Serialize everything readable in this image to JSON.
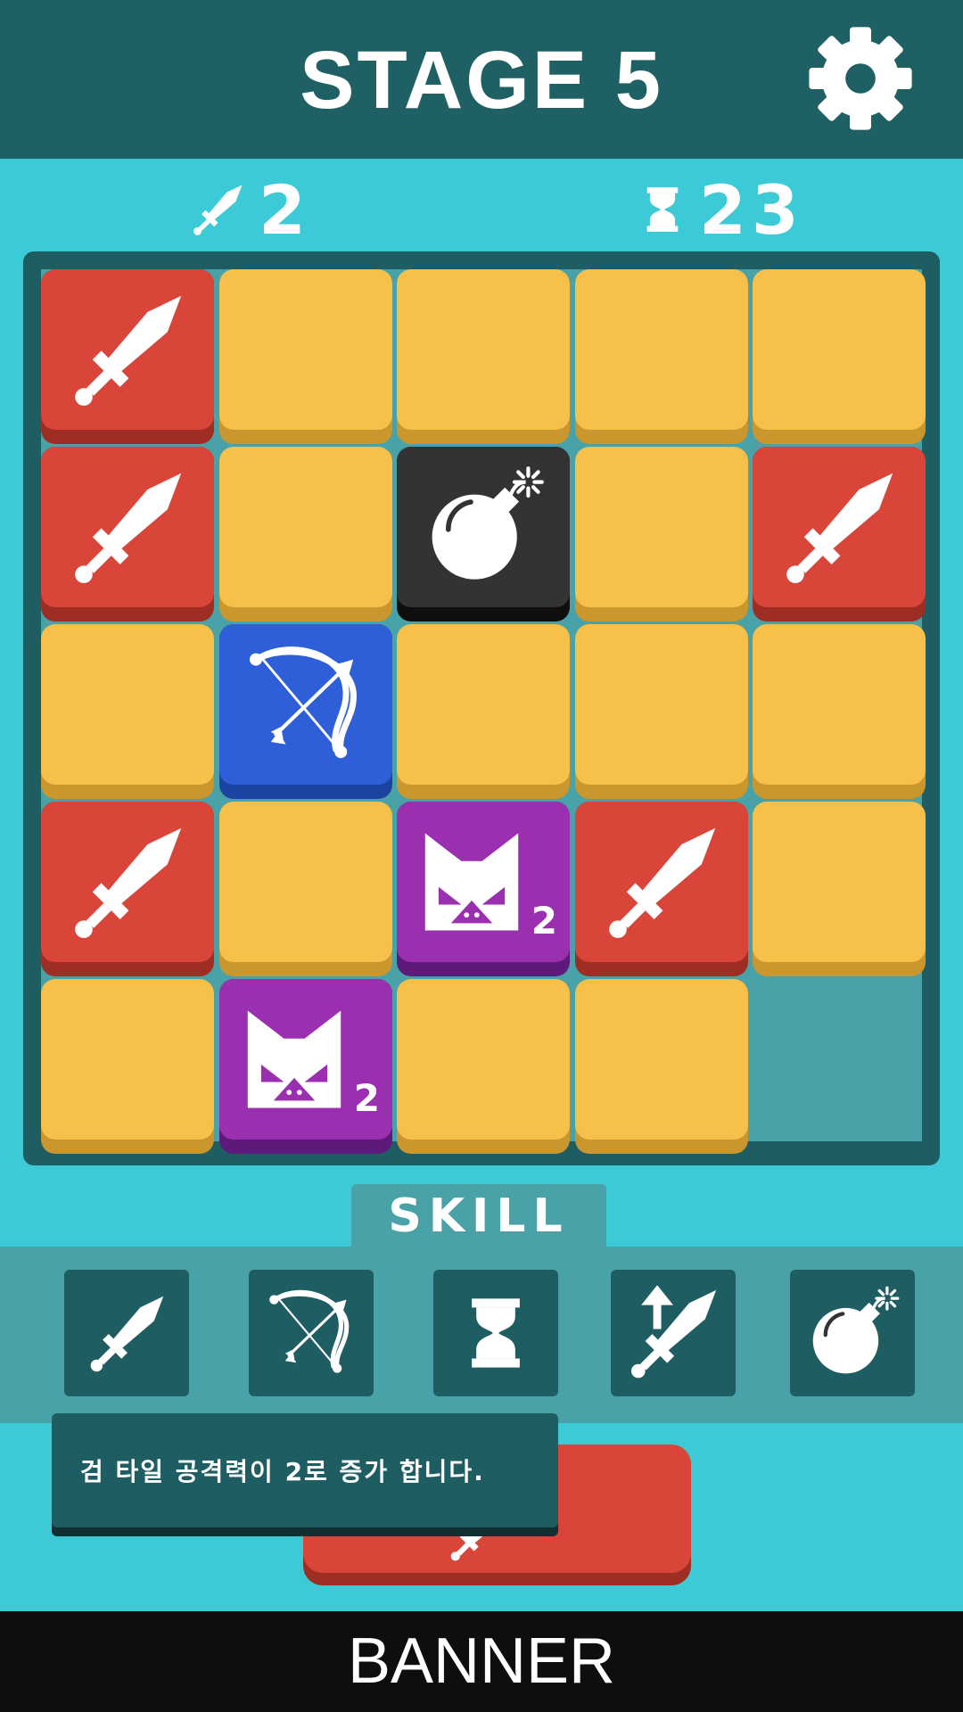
{
  "header": {
    "title": "STAGE 5",
    "settings_icon": "gear-icon"
  },
  "stats": {
    "attack": "2",
    "attack_icon": "sword-icon",
    "turns": "23",
    "turns_icon": "hourglass-icon"
  },
  "board": {
    "rows": [
      [
        {
          "type": "sword"
        },
        {
          "type": "empty"
        },
        {
          "type": "empty"
        },
        {
          "type": "empty"
        },
        {
          "type": "empty"
        }
      ],
      [
        {
          "type": "sword"
        },
        {
          "type": "empty"
        },
        {
          "type": "bomb"
        },
        {
          "type": "empty"
        },
        {
          "type": "sword"
        }
      ],
      [
        {
          "type": "empty"
        },
        {
          "type": "bow"
        },
        {
          "type": "empty"
        },
        {
          "type": "empty"
        },
        {
          "type": "empty"
        }
      ],
      [
        {
          "type": "sword"
        },
        {
          "type": "empty"
        },
        {
          "type": "enemy",
          "count": "2"
        },
        {
          "type": "sword"
        },
        {
          "type": "empty"
        }
      ],
      [
        {
          "type": "empty"
        },
        {
          "type": "enemy",
          "count": "2"
        },
        {
          "type": "empty"
        },
        {
          "type": "empty"
        },
        {
          "type": "none"
        }
      ]
    ]
  },
  "skill": {
    "label": "SKILL",
    "buttons": [
      {
        "icon": "sword-icon"
      },
      {
        "icon": "bow-icon"
      },
      {
        "icon": "hourglass-icon"
      },
      {
        "icon": "sword-up-icon"
      },
      {
        "icon": "bomb-icon"
      }
    ]
  },
  "tooltip": {
    "text": "검 타일 공격력이 2로 증가 합니다."
  },
  "banner": {
    "text": "BANNER"
  },
  "colors": {
    "header": "#1e6064",
    "background": "#3bcad6",
    "sword": "#d94639",
    "empty": "#f7c04a",
    "bow": "#2e5fd9",
    "bomb": "#333333",
    "enemy": "#9a2fb0"
  }
}
